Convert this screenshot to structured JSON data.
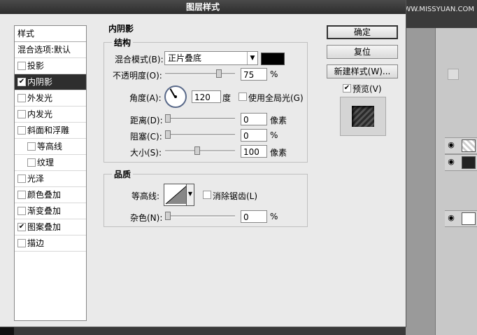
{
  "window": {
    "title": "图层样式"
  },
  "watermark": "思缘设计论坛 WWW.MISSYUAN.COM",
  "style_list": {
    "header": "样式",
    "items": [
      {
        "label": "混合选项:默认",
        "checked": null,
        "indent": 0,
        "active": false
      },
      {
        "label": "投影",
        "checked": "",
        "indent": 1,
        "active": false
      },
      {
        "label": "内阴影",
        "checked": "✔",
        "indent": 1,
        "active": true
      },
      {
        "label": "外发光",
        "checked": "",
        "indent": 1,
        "active": false
      },
      {
        "label": "内发光",
        "checked": "",
        "indent": 1,
        "active": false
      },
      {
        "label": "斜面和浮雕",
        "checked": "",
        "indent": 1,
        "active": false
      },
      {
        "label": "等高线",
        "checked": "",
        "indent": 2,
        "active": false
      },
      {
        "label": "纹理",
        "checked": "",
        "indent": 2,
        "active": false
      },
      {
        "label": "光泽",
        "checked": "",
        "indent": 1,
        "active": false
      },
      {
        "label": "颜色叠加",
        "checked": "",
        "indent": 1,
        "active": false
      },
      {
        "label": "渐变叠加",
        "checked": "",
        "indent": 1,
        "active": false
      },
      {
        "label": "图案叠加",
        "checked": "✔",
        "indent": 1,
        "active": false
      },
      {
        "label": "描边",
        "checked": "",
        "indent": 1,
        "active": false
      }
    ]
  },
  "inner_shadow": {
    "title": "内阴影",
    "structure": {
      "title": "结构",
      "blend_mode_label": "混合模式(B):",
      "blend_mode_value": "正片叠底",
      "blend_color": "#000000",
      "opacity_label": "不透明度(O):",
      "opacity_value": "75",
      "opacity_unit": "%",
      "angle_label": "角度(A):",
      "angle_value": "120",
      "angle_unit": "度",
      "global_light_label": "使用全局光(G)",
      "global_light_checked": "",
      "distance_label": "距离(D):",
      "distance_value": "0",
      "distance_unit": "像素",
      "choke_label": "阻塞(C):",
      "choke_value": "0",
      "choke_unit": "%",
      "size_label": "大小(S):",
      "size_value": "100",
      "size_unit": "像素"
    },
    "quality": {
      "title": "品质",
      "contour_label": "等高线:",
      "anti_alias_label": "消除锯齿(L)",
      "anti_alias_checked": "",
      "noise_label": "杂色(N):",
      "noise_value": "0",
      "noise_unit": "%"
    }
  },
  "buttons": {
    "ok": "确定",
    "reset": "复位",
    "new_style": "新建样式(W)...",
    "preview_label": "预览(V)",
    "preview_checked": "✔"
  }
}
